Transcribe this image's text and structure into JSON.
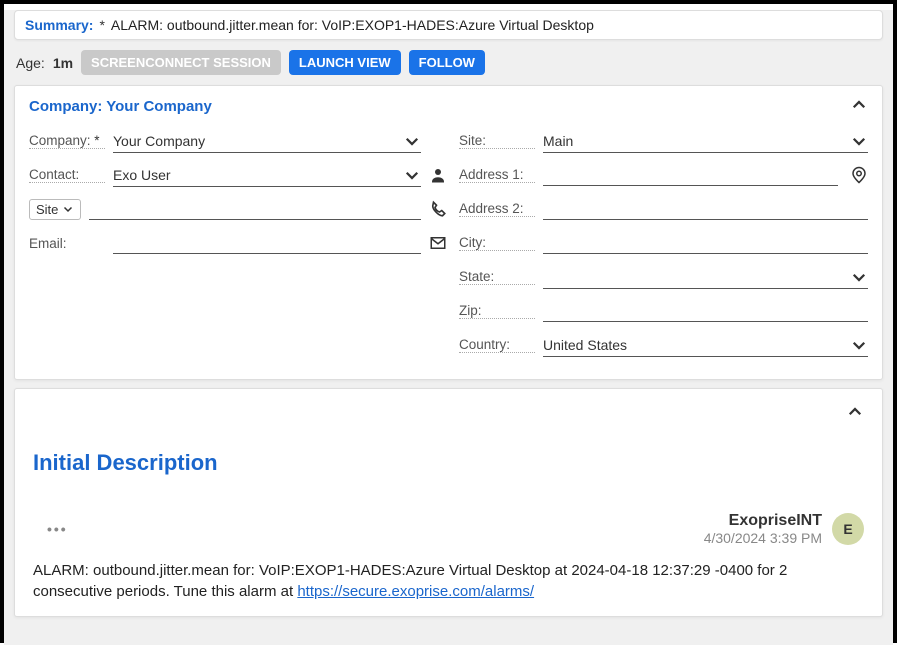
{
  "summary": {
    "label": "Summary:",
    "required": "*",
    "text": "ALARM: outbound.jitter.mean for: VoIP:EXOP1-HADES:Azure Virtual Desktop"
  },
  "actions": {
    "age_label": "Age:",
    "age_value": "1m",
    "screenconnect": "SCREENCONNECT SESSION",
    "launch_view": "LAUNCH VIEW",
    "follow": "FOLLOW"
  },
  "company_panel": {
    "title": "Company: Your Company",
    "left": {
      "company_label": "Company:",
      "company_req": "*",
      "company_value": "Your Company",
      "contact_label": "Contact:",
      "contact_value": "Exo User",
      "site_chip": "Site",
      "email_label": "Email:"
    },
    "right": {
      "site_label": "Site:",
      "site_value": "Main",
      "addr1_label": "Address 1:",
      "addr2_label": "Address 2:",
      "city_label": "City:",
      "state_label": "State:",
      "zip_label": "Zip:",
      "country_label": "Country:",
      "country_value": "United States"
    }
  },
  "description": {
    "title": "Initial Description",
    "user": "ExopriseINT",
    "avatar_letter": "E",
    "timestamp": "4/30/2024 3:39 PM",
    "body_prefix": "ALARM: outbound.jitter.mean for: VoIP:EXOP1-HADES:Azure Virtual Desktop at 2024-04-18 12:37:29 -0400 for 2 consecutive periods. Tune this alarm at ",
    "body_link": "https://secure.exoprise.com/alarms/"
  }
}
